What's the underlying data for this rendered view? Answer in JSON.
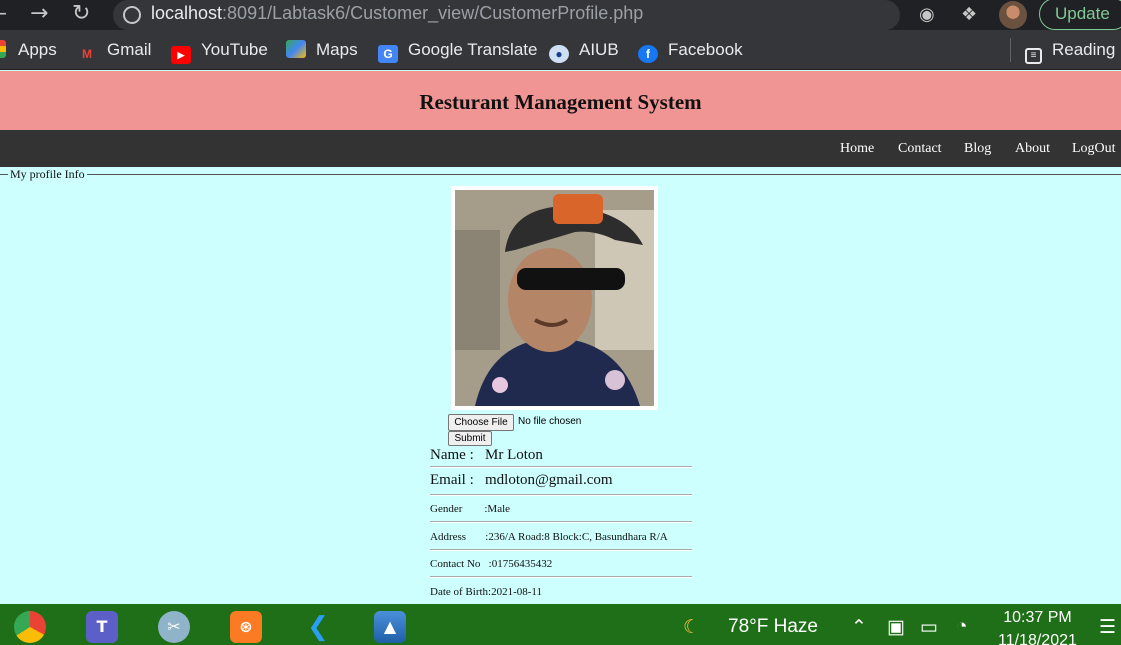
{
  "browser": {
    "url_host": "localhost",
    "url_path": ":8091/Labtask6/Customer_view/CustomerProfile.php",
    "update_label": "Update",
    "bookmarks": [
      {
        "label": "Apps",
        "icon": "apps-grid-icon"
      },
      {
        "label": "Gmail",
        "icon": "gmail-icon"
      },
      {
        "label": "YouTube",
        "icon": "youtube-icon"
      },
      {
        "label": "Maps",
        "icon": "maps-icon"
      },
      {
        "label": "Google Translate",
        "icon": "translate-icon"
      },
      {
        "label": "AIUB",
        "icon": "aiub-icon"
      },
      {
        "label": "Facebook",
        "icon": "facebook-icon"
      }
    ],
    "reading_list_label": "Reading l"
  },
  "header": {
    "title": "Resturant Management System"
  },
  "nav": {
    "items": [
      "Home",
      "Contact",
      "Blog",
      "About",
      "LogOut"
    ]
  },
  "profile": {
    "legend": "My profile Info",
    "upload": {
      "choose_label": "Choose File",
      "status": "No file chosen",
      "submit_label": "Submit"
    },
    "name": "Name :   Mr Loton",
    "email": "Email :   mdloton@gmail.com",
    "gender": "Gender        :Male",
    "address": "Address       :236/A Road:8 Block:C, Basundhara R/A",
    "contact": "Contact No   :01756435432",
    "dob": "Date of Birth:2021-08-11"
  },
  "taskbar": {
    "weather": "78°F  Haze",
    "time": "10:37 PM",
    "date": "11/18/2021"
  },
  "colors": {
    "header_bg": "#f19594",
    "nav_bg": "#333333",
    "page_bg": "#ccfffe",
    "taskbar_bg": "#1f6f18"
  }
}
